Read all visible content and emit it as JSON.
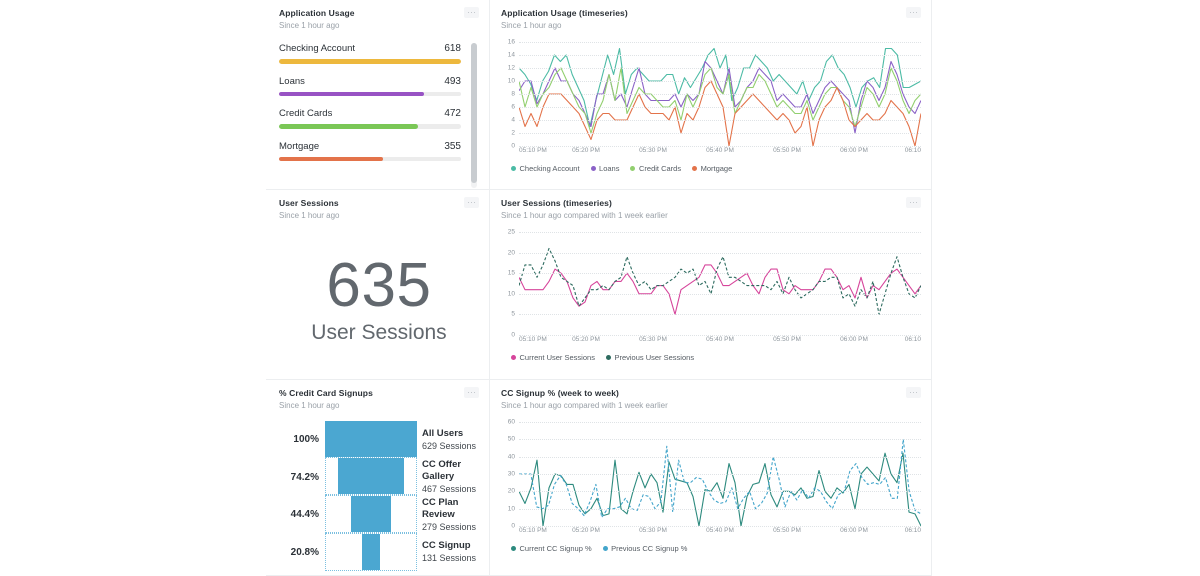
{
  "panels": {
    "app_usage": {
      "title": "Application Usage",
      "subtitle": "Since 1 hour ago",
      "bars": [
        {
          "label": "Checking Account",
          "value": "618",
          "pct": 100,
          "color": "#edb83d"
        },
        {
          "label": "Loans",
          "value": "493",
          "pct": 79.8,
          "color": "#9853c4"
        },
        {
          "label": "Credit Cards",
          "value": "472",
          "pct": 76.4,
          "color": "#7ac756"
        },
        {
          "label": "Mortgage",
          "value": "355",
          "pct": 57.4,
          "color": "#e3734a"
        }
      ]
    },
    "app_usage_ts": {
      "title": "Application Usage (timeseries)",
      "subtitle": "Since 1 hour ago"
    },
    "user_sessions": {
      "title": "User Sessions",
      "subtitle": "Since 1 hour ago",
      "big_value": "635",
      "big_caption": "User Sessions"
    },
    "user_sessions_ts": {
      "title": "User Sessions (timeseries)",
      "subtitle": "Since 1 hour ago compared with 1 week earlier"
    },
    "cc_signups": {
      "title": "% Credit Card Signups",
      "subtitle": "Since 1 hour ago",
      "stages": [
        {
          "pct": "100%",
          "name": "All Users",
          "sessions": "629 Sessions",
          "width": 100,
          "dashed": false
        },
        {
          "pct": "74.2%",
          "name": "CC Offer Gallery",
          "sessions": "467 Sessions",
          "width": 74.2,
          "dashed": true
        },
        {
          "pct": "44.4%",
          "name": "CC Plan Review",
          "sessions": "279 Sessions",
          "width": 44.4,
          "dashed": true
        },
        {
          "pct": "20.8%",
          "name": "CC Signup",
          "sessions": "131 Sessions",
          "width": 20.8,
          "dashed": true
        }
      ]
    },
    "cc_signup_ts": {
      "title": "CC Signup % (week to week)",
      "subtitle": "Since 1 hour ago compared with 1 week earlier"
    }
  },
  "icons": {
    "kebab": "ellipsis-icon"
  },
  "chart_data": [
    {
      "id": "app_usage_ts",
      "type": "line",
      "title": "Application Usage (timeseries)",
      "subtitle": "Since 1 hour ago",
      "xlabel": "",
      "ylabel": "",
      "ylim": [
        0,
        16
      ],
      "yticks": [
        0,
        2,
        4,
        6,
        8,
        10,
        12,
        14,
        16
      ],
      "grid": true,
      "legend_position": "bottom",
      "xticks": [
        "05:10 PM",
        "05:20 PM",
        "05:30 PM",
        "05:40 PM",
        "05:50 PM",
        "06:00 PM",
        "06:10"
      ],
      "series": [
        {
          "name": "Checking Account",
          "color": "#4cbba5",
          "dash": false,
          "values": [
            12,
            11,
            9.5,
            7,
            10,
            11.5,
            14,
            13,
            14,
            11,
            9,
            7,
            3,
            7,
            10.5,
            14,
            11,
            15,
            8,
            11,
            12,
            11,
            10,
            10,
            10,
            11,
            11,
            8,
            10.5,
            9,
            10.5,
            12,
            14,
            15,
            12,
            14,
            7,
            9,
            12,
            12,
            14,
            13,
            12,
            10,
            11,
            10,
            9,
            8,
            10,
            7,
            9,
            10,
            13,
            14,
            12,
            11,
            9,
            6,
            9,
            10,
            10.5,
            9,
            15,
            15,
            14,
            9,
            9,
            9.5,
            10
          ]
        },
        {
          "name": "Loans",
          "color": "#8b62c7",
          "dash": false,
          "values": [
            8.5,
            10,
            10,
            6.5,
            8,
            10,
            12,
            10,
            10,
            8,
            7,
            5,
            3,
            8,
            8,
            11,
            7,
            8,
            6,
            9,
            12,
            8,
            7,
            7,
            7,
            7,
            8,
            6,
            8,
            7,
            8,
            13,
            12,
            10,
            8,
            12,
            6,
            7,
            9,
            10,
            12,
            11,
            10,
            7,
            8,
            7,
            6,
            6,
            8,
            5,
            7,
            9,
            10,
            9,
            8,
            7,
            2,
            7,
            10,
            9,
            7,
            9,
            13,
            11,
            8,
            6,
            5,
            7
          ]
        },
        {
          "name": "Credit Cards",
          "color": "#92cf6f",
          "dash": false,
          "values": [
            10,
            6,
            9,
            6,
            8,
            9,
            11,
            12,
            10,
            8,
            6,
            5,
            2,
            5,
            7,
            11,
            7,
            12,
            5,
            7,
            9,
            8,
            8,
            7,
            6,
            6,
            7,
            4,
            8,
            6,
            8,
            11,
            12,
            9,
            8,
            11,
            5,
            7,
            9,
            9,
            11,
            10,
            8,
            6,
            7,
            6,
            5,
            5,
            7,
            4,
            6,
            8,
            9,
            9,
            7,
            6,
            3,
            6,
            9,
            8,
            6,
            8,
            12,
            10,
            7,
            5,
            7,
            8
          ]
        },
        {
          "name": "Mortgage",
          "color": "#e3734a",
          "dash": false,
          "values": [
            6,
            3,
            5,
            3,
            6,
            8,
            8,
            8,
            7,
            6,
            5,
            3,
            1,
            4,
            5,
            5,
            4,
            4,
            4,
            6,
            8,
            6,
            5,
            5,
            5,
            4,
            6,
            2,
            5,
            4,
            6,
            9,
            10,
            8,
            6,
            0,
            5,
            6,
            7,
            8,
            7,
            6,
            5,
            4,
            5,
            4,
            2,
            3,
            6,
            0,
            4,
            6,
            7,
            9,
            7,
            4,
            3,
            4,
            5,
            4,
            4,
            5,
            7,
            6,
            5,
            3,
            0,
            5
          ]
        }
      ]
    },
    {
      "id": "user_sessions_ts",
      "type": "line",
      "title": "User Sessions (timeseries)",
      "subtitle": "Since 1 hour ago compared with 1 week earlier",
      "xlabel": "",
      "ylabel": "",
      "ylim": [
        0,
        25
      ],
      "yticks": [
        0,
        5,
        10,
        15,
        20,
        25
      ],
      "grid": true,
      "legend_position": "bottom",
      "xticks": [
        "05:10 PM",
        "05:20 PM",
        "05:30 PM",
        "05:40 PM",
        "05:50 PM",
        "06:00 PM",
        "06:10"
      ],
      "series": [
        {
          "name": "Current User Sessions",
          "color": "#d6459b",
          "dash": false,
          "values": [
            14,
            11,
            11,
            11,
            11,
            13,
            16,
            15,
            13,
            9,
            7,
            8,
            12,
            13,
            11,
            11,
            13,
            13,
            15,
            13,
            10,
            10,
            10,
            12,
            12,
            10,
            5,
            11,
            12,
            13,
            14,
            17,
            17,
            15,
            12,
            12,
            13,
            14,
            15,
            12,
            10,
            14,
            16,
            16,
            11,
            10,
            12,
            11,
            11,
            11,
            13,
            16,
            16,
            14,
            11,
            12,
            9,
            14,
            9,
            12,
            11,
            13,
            15,
            16,
            14,
            12,
            10,
            12
          ]
        },
        {
          "name": "Previous User Sessions",
          "color": "#2d6b5f",
          "dash": true,
          "values": [
            12,
            17,
            17,
            14,
            17,
            21,
            18,
            14,
            13,
            12,
            7,
            9,
            11,
            11,
            12,
            11,
            13,
            14,
            19,
            15,
            12,
            13,
            11,
            12,
            12,
            13,
            14,
            16,
            15,
            16,
            12,
            13,
            10,
            16,
            19,
            14,
            14,
            13,
            12,
            12,
            12,
            12,
            11,
            13,
            10,
            14,
            11,
            9,
            10,
            11,
            13,
            13,
            14,
            14,
            9,
            10,
            7,
            11,
            9,
            13,
            5,
            10,
            15,
            19,
            14,
            10,
            9,
            12
          ]
        }
      ]
    },
    {
      "id": "cc_signup_ts",
      "type": "line",
      "title": "CC Signup % (week to week)",
      "subtitle": "Since 1 hour ago compared with 1 week earlier",
      "xlabel": "",
      "ylabel": "",
      "ylim": [
        0,
        60
      ],
      "yticks": [
        0,
        10,
        20,
        30,
        40,
        50,
        60
      ],
      "grid": true,
      "legend_position": "bottom",
      "xticks": [
        "05:10 PM",
        "05:20 PM",
        "05:30 PM",
        "05:40 PM",
        "05:50 PM",
        "06:00 PM",
        "06:10"
      ],
      "series": [
        {
          "name": "Current CC Signup %",
          "color": "#2d8a7e",
          "dash": false,
          "values": [
            20,
            13,
            22,
            38,
            -1,
            22,
            30,
            29,
            24,
            24,
            12,
            7,
            10,
            16,
            6,
            7,
            38,
            10,
            7,
            20,
            31,
            22,
            30,
            25,
            8,
            37,
            27,
            26,
            25,
            17,
            -1,
            21,
            20,
            25,
            16,
            36,
            25,
            -1,
            17,
            24,
            25,
            36,
            18,
            11,
            20,
            20,
            18,
            22,
            16,
            17,
            32,
            20,
            16,
            22,
            19,
            24,
            10,
            30,
            34,
            30,
            26,
            42,
            30,
            25,
            42,
            8,
            7,
            -2
          ]
        },
        {
          "name": "Previous CC Signup %",
          "color": "#43a5cb",
          "dash": true,
          "values": [
            30,
            30,
            30,
            11,
            10,
            12,
            24,
            29,
            24,
            13,
            10,
            6,
            14,
            24,
            5,
            10,
            10,
            11,
            16,
            10,
            9,
            18,
            17,
            10,
            14,
            46,
            8,
            38,
            25,
            25,
            28,
            27,
            20,
            15,
            13,
            14,
            22,
            10,
            16,
            20,
            10,
            13,
            19,
            40,
            27,
            11,
            20,
            15,
            21,
            16,
            22,
            20,
            14,
            10,
            18,
            20,
            32,
            36,
            28,
            24,
            25,
            24,
            28,
            16,
            16,
            50,
            20,
            9,
            7
          ]
        }
      ]
    }
  ]
}
